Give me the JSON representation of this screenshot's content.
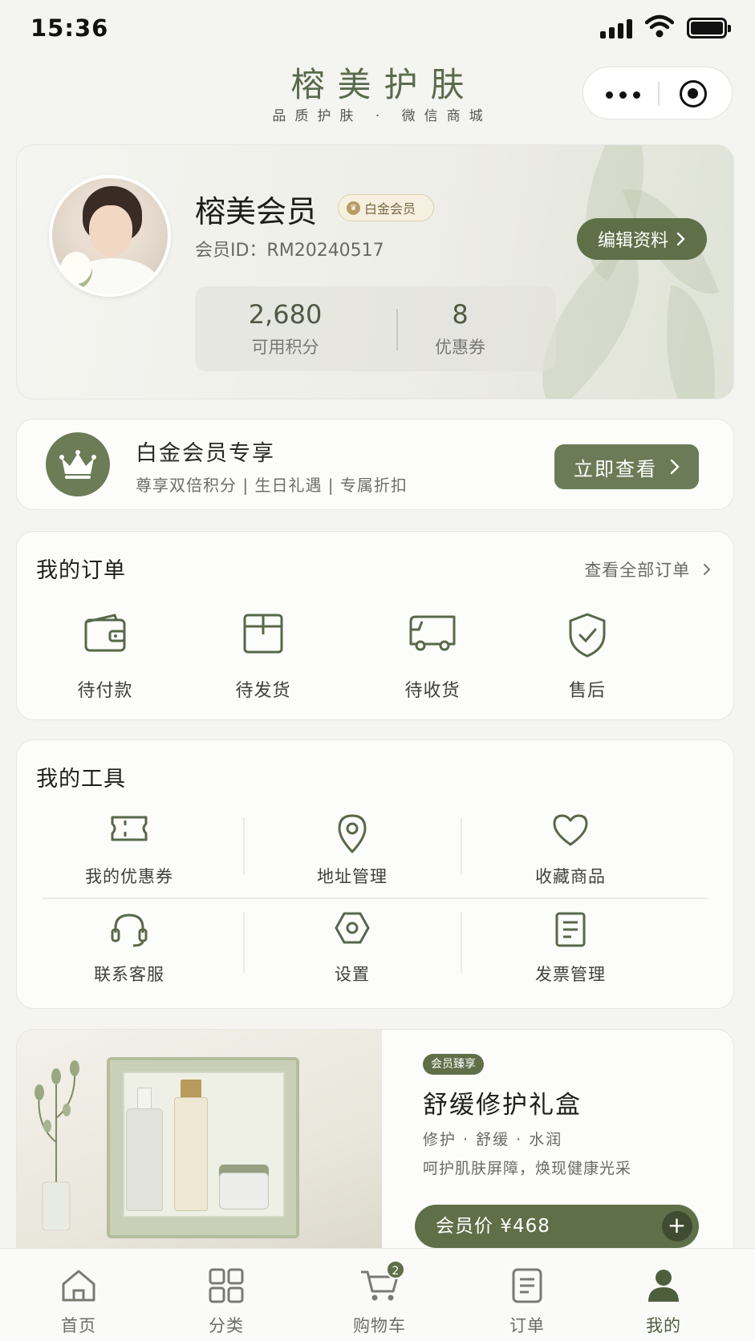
{
  "status_bar": {
    "time": "15:36"
  },
  "header": {
    "title": "榕美护肤",
    "subtitle": "品质护肤 · 微信商城"
  },
  "profile": {
    "name": "榕美会员",
    "badge": "白金会员",
    "member_id": "会员ID：RM20240517",
    "edit_label": "编辑资料",
    "points_value": "2,680",
    "points_label": "可用积分",
    "coupons_value": "8",
    "coupons_label": "优惠券"
  },
  "vip": {
    "title": "白金会员专享",
    "desc": "尊享双倍积分 | 生日礼遇 | 专属折扣",
    "button": "立即查看"
  },
  "orders": {
    "title": "我的订单",
    "view_all": "查看全部订单",
    "items": [
      {
        "label": "待付款",
        "icon": "wallet-icon"
      },
      {
        "label": "待发货",
        "icon": "package-icon"
      },
      {
        "label": "待收货",
        "icon": "truck-icon"
      },
      {
        "label": "售后",
        "icon": "shield-check-icon"
      }
    ]
  },
  "tools": {
    "title": "我的工具",
    "items": [
      {
        "label": "我的优惠券",
        "icon": "ticket-icon"
      },
      {
        "label": "地址管理",
        "icon": "location-pin-icon"
      },
      {
        "label": "收藏商品",
        "icon": "heart-icon"
      },
      {
        "label": "联系客服",
        "icon": "headset-icon"
      },
      {
        "label": "设置",
        "icon": "settings-hexagon-icon"
      },
      {
        "label": "发票管理",
        "icon": "invoice-icon"
      }
    ]
  },
  "promo": {
    "tag": "会员臻享",
    "title": "舒缓修护礼盒",
    "tags": "修护 · 舒缓 · 水润",
    "desc": "呵护肌肤屏障，焕现健康光采",
    "price": "会员价 ¥468"
  },
  "tabbar": {
    "items": [
      {
        "label": "首页",
        "icon": "home-icon"
      },
      {
        "label": "分类",
        "icon": "grid-icon"
      },
      {
        "label": "购物车",
        "icon": "cart-icon",
        "badge": "2"
      },
      {
        "label": "订单",
        "icon": "order-doc-icon"
      },
      {
        "label": "我的",
        "icon": "user-icon",
        "active": true
      }
    ]
  },
  "colors": {
    "accent": "#5f7049",
    "background": "#f4f4f1",
    "card": "#fcfcfa"
  }
}
